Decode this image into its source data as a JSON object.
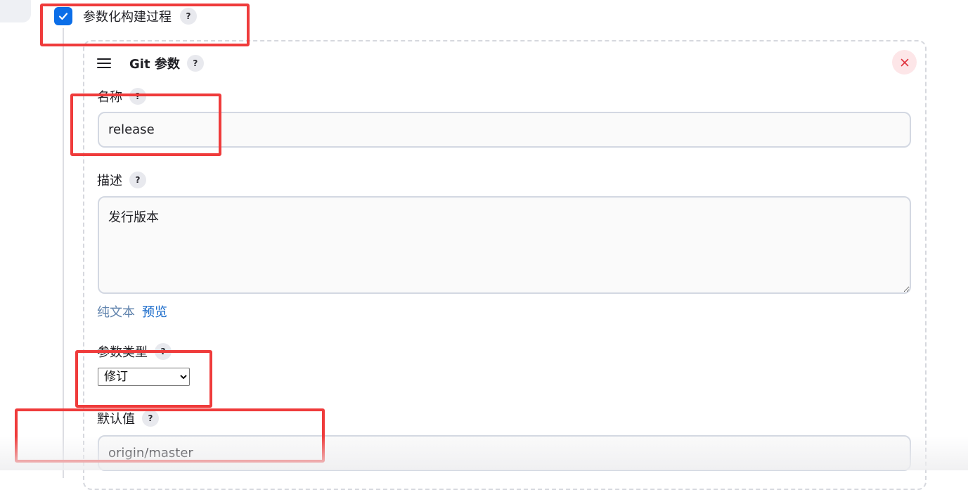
{
  "build": {
    "parameterized_label": "参数化构建过程",
    "parameterized_checked": true,
    "help_glyph": "?"
  },
  "panel": {
    "title": "Git 参数",
    "fields": {
      "name": {
        "label": "名称",
        "value": "release"
      },
      "description": {
        "label": "描述",
        "value": "发行版本"
      },
      "format": {
        "plain": "纯文本",
        "preview": "预览"
      },
      "param_type": {
        "label": "参数类型",
        "selected": "修订"
      },
      "default_value": {
        "label": "默认值",
        "value": "origin/master"
      }
    }
  },
  "colors": {
    "accent": "#0b6ee8",
    "annotation_box": "#ef3b3b",
    "link": "#1266c9",
    "link_muted": "#6083ad",
    "danger_bg": "#fde6e8",
    "danger_icon": "#e0323e"
  },
  "icons": {
    "checkbox": "checkmark-icon",
    "handle": "drag-handle-icon",
    "close": "close-icon",
    "help": "help-icon"
  }
}
